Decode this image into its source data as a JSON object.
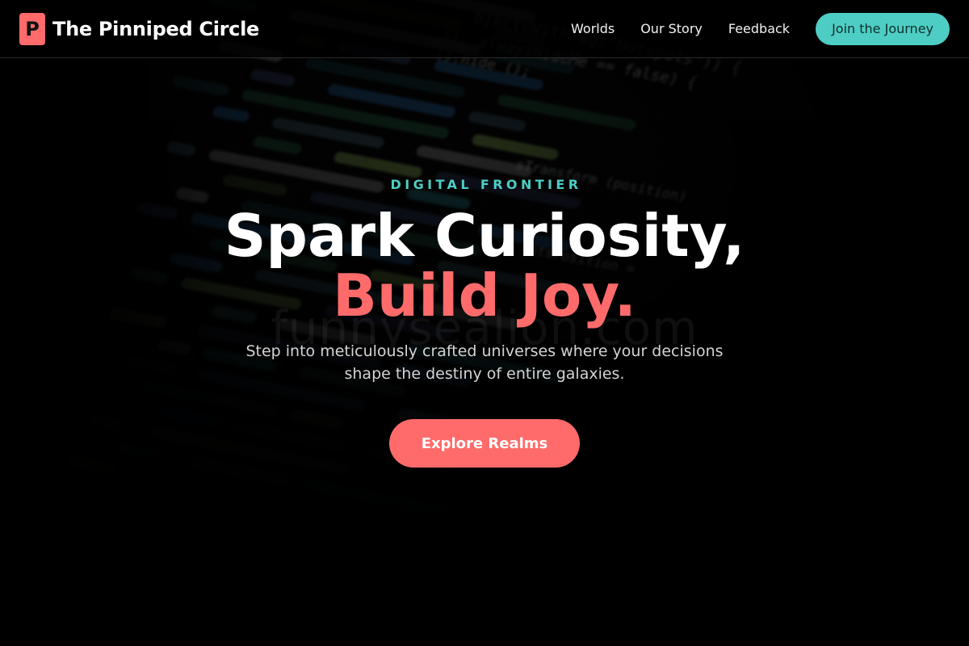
{
  "header": {
    "logo_letter": "P",
    "brand_name": "The Pinniped Circle",
    "nav": [
      {
        "label": "Worlds"
      },
      {
        "label": "Our Story"
      },
      {
        "label": "Feedback"
      }
    ],
    "cta_label": "Join the Journey"
  },
  "hero": {
    "eyebrow": "DIGITAL FRONTIER",
    "headline_line1": "Spark Curiosity,",
    "headline_line2": "Build Joy.",
    "subtitle": "Step into meticulously crafted universes where your decisions shape the destiny of entire galaxies.",
    "cta_label": "Explore Realms"
  },
  "background": {
    "watermark": "funnysealion.com",
    "code_snippets": [
      "bjectsWithTag(\"Hotspots\")) {",
      "(). alwaysHideMe == false) {",
      "().hide ();",
      "sTransform (position)",
      "ntsPosition =",
      "tspots\")) {"
    ]
  },
  "colors": {
    "accent_coral": "#ff6b6b",
    "accent_teal": "#4ecdc4",
    "background": "#020202"
  },
  "icons": {
    "logo": "letter-p-badge"
  }
}
